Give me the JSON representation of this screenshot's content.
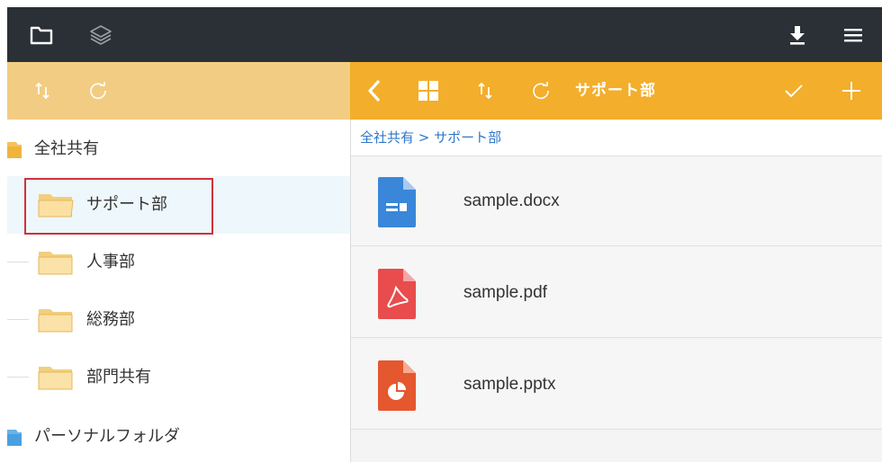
{
  "topbar": {
    "icons": [
      "folder-icon",
      "layers-icon",
      "download-icon",
      "menu-icon"
    ]
  },
  "left_toolbar": {
    "icons": [
      "sort-icon",
      "refresh-icon"
    ]
  },
  "right_toolbar": {
    "icons": [
      "back-chevron-icon",
      "grid-view-icon",
      "sort-icon",
      "refresh-icon",
      "check-icon",
      "plus-icon"
    ],
    "title": "サポート部"
  },
  "tree": {
    "root": "全社共有",
    "children": [
      {
        "label": "サポート部",
        "selected": true
      },
      {
        "label": "人事部",
        "selected": false
      },
      {
        "label": "総務部",
        "selected": false
      },
      {
        "label": "部門共有",
        "selected": false
      }
    ],
    "personal": "パーソナルフォルダ"
  },
  "breadcrumb": "全社共有 > サポート部",
  "files": [
    {
      "name": "sample.docx",
      "type": "docx",
      "color": "#3a86d9"
    },
    {
      "name": "sample.pdf",
      "type": "pdf",
      "color": "#e84c4c"
    },
    {
      "name": "sample.pptx",
      "type": "pptx",
      "color": "#e5572e"
    }
  ],
  "colors": {
    "topbar_bg": "#2b2f36",
    "left_toolbar_bg": "#f2cc82",
    "right_toolbar_bg": "#f3ae2b",
    "selection_border": "#d0323a",
    "breadcrumb_text": "#2f77c8"
  }
}
